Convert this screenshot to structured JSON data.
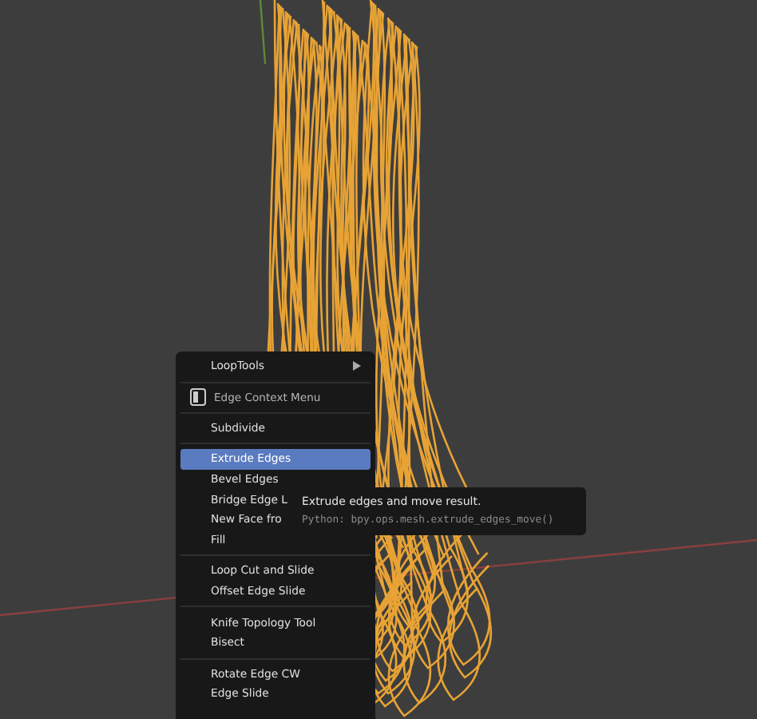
{
  "menu": {
    "sections": [
      {
        "items": [
          {
            "label": "LoopTools",
            "submenu": true,
            "selected": false
          }
        ]
      },
      {
        "header": "Edge Context Menu"
      },
      {
        "items": [
          {
            "label": "Subdivide",
            "submenu": false,
            "selected": false
          }
        ]
      },
      {
        "items": [
          {
            "label": "Extrude Edges",
            "submenu": false,
            "selected": true
          },
          {
            "label": "Bevel Edges",
            "submenu": false,
            "selected": false
          },
          {
            "label": "Bridge Edge L",
            "submenu": false,
            "selected": false
          },
          {
            "label": "New Face fro",
            "submenu": false,
            "selected": false
          },
          {
            "label": "Fill",
            "submenu": false,
            "selected": false
          }
        ]
      },
      {
        "items": [
          {
            "label": "Loop Cut and Slide",
            "submenu": false,
            "selected": false
          },
          {
            "label": "Offset Edge Slide",
            "submenu": false,
            "selected": false
          }
        ]
      },
      {
        "items": [
          {
            "label": "Knife Topology Tool",
            "submenu": false,
            "selected": false
          },
          {
            "label": "Bisect",
            "submenu": false,
            "selected": false
          }
        ]
      },
      {
        "items": [
          {
            "label": "Rotate Edge CW",
            "submenu": false,
            "selected": false
          },
          {
            "label": "Edge Slide",
            "submenu": false,
            "selected": false
          }
        ]
      }
    ]
  },
  "tooltip": {
    "description": "Extrude edges and move result.",
    "python": "Python: bpy.ops.mesh.extrude_edges_move()"
  }
}
